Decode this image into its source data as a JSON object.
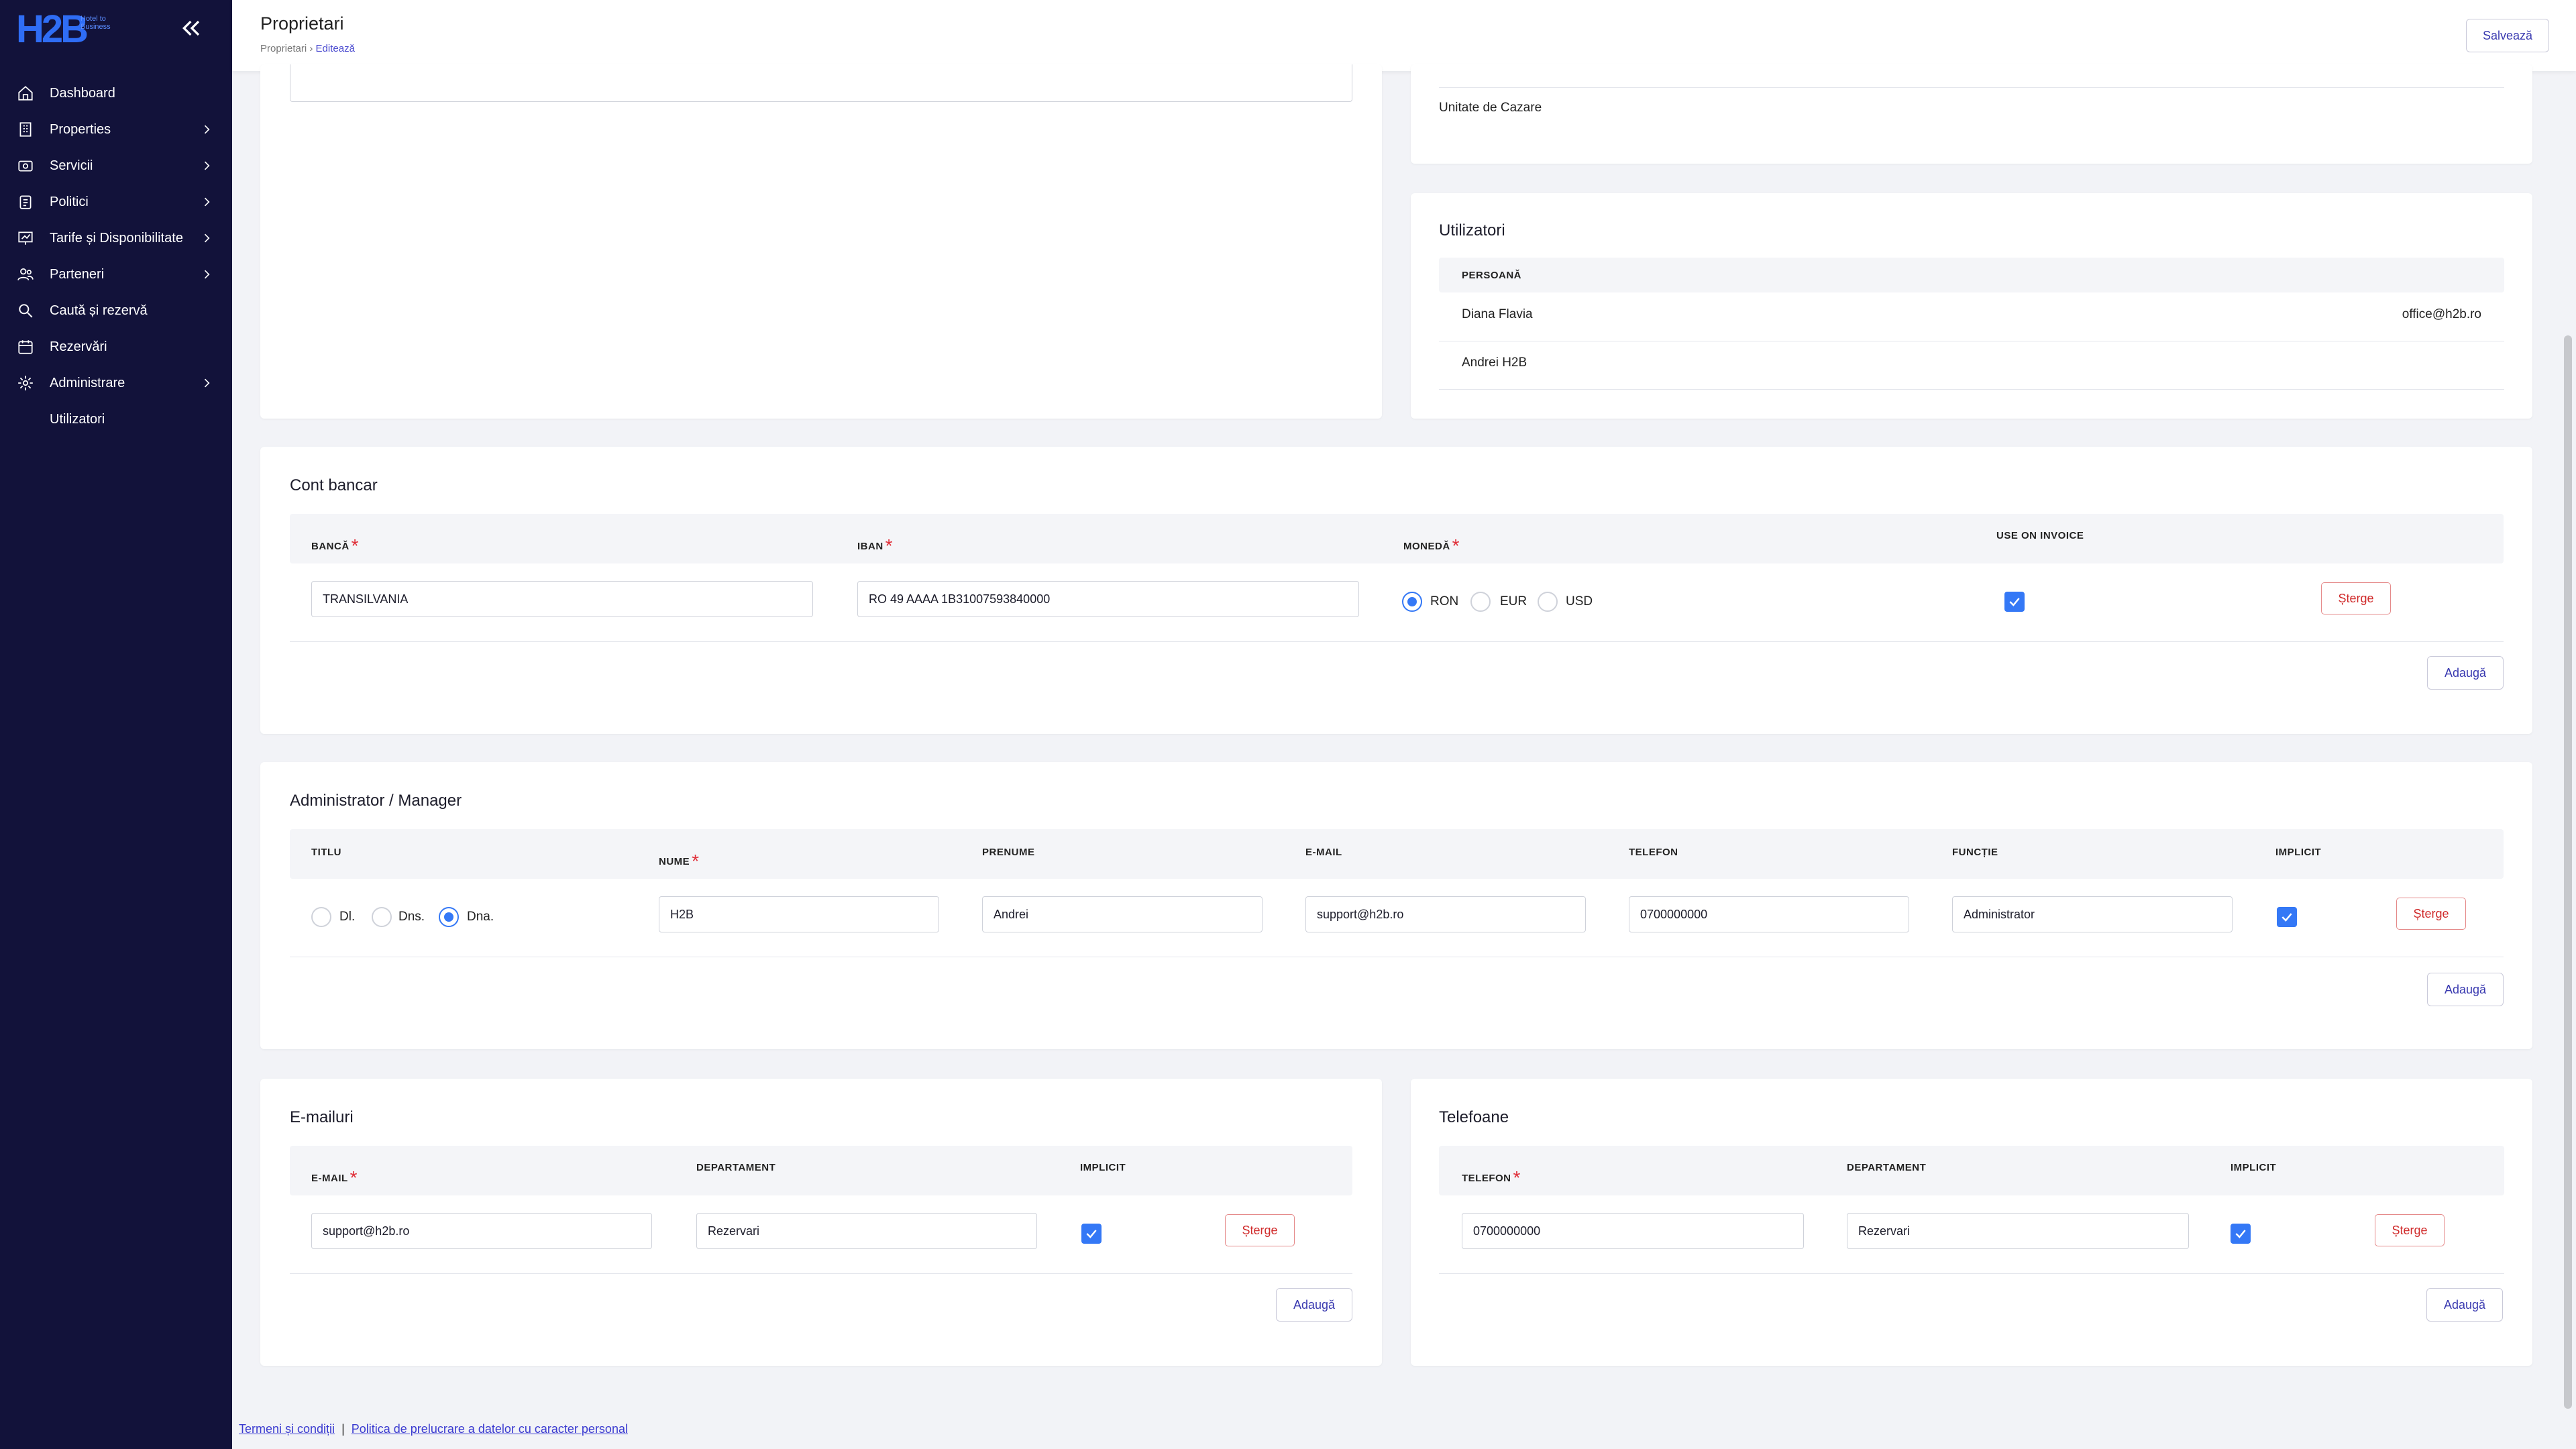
{
  "app": {
    "logo_text": "H2B",
    "logo_sub": "Hotel to Business"
  },
  "sidebar": {
    "items": [
      {
        "label": "Dashboard"
      },
      {
        "label": "Properties"
      },
      {
        "label": "Servicii"
      },
      {
        "label": "Politici"
      },
      {
        "label": "Tarife și Disponibilitate"
      },
      {
        "label": "Parteneri"
      },
      {
        "label": "Caută și rezervă"
      },
      {
        "label": "Rezervări"
      },
      {
        "label": "Administrare"
      },
      {
        "label": "Utilizatori"
      }
    ]
  },
  "header": {
    "title": "Proprietari",
    "breadcrumb_root": "Proprietari",
    "breadcrumb_sep": "›",
    "breadcrumb_current": "Editează",
    "save_label": "Salvează"
  },
  "top_right": {
    "unit_label": "Unitate de Cazare"
  },
  "users": {
    "title": "Utilizatori",
    "col_person": "PERSOANĂ",
    "rows": [
      {
        "name": "Diana Flavia",
        "email": "office@h2b.ro"
      },
      {
        "name": "Andrei H2B",
        "email": ""
      }
    ]
  },
  "bank": {
    "title": "Cont bancar",
    "col_bank": "BANCĂ",
    "col_iban": "IBAN",
    "col_currency": "MONEDĂ",
    "col_invoice": "USE ON INVOICE",
    "row": {
      "bank": "TRANSILVANIA",
      "iban": "RO 49 AAAA 1B31007593840000",
      "currency_options": [
        "RON",
        "EUR",
        "USD"
      ],
      "currency_selected": "RON",
      "use_on_invoice": true
    },
    "delete_label": "Șterge",
    "add_label": "Adaugă"
  },
  "admin": {
    "title": "Administrator / Manager",
    "col_title": "TITLU",
    "col_name": "NUME",
    "col_firstname": "PRENUME",
    "col_email": "E-MAIL",
    "col_phone": "TELEFON",
    "col_function": "FUNCȚIE",
    "col_default": "IMPLICIT",
    "row": {
      "title_options": [
        "Dl.",
        "Dns.",
        "Dna."
      ],
      "title_selected": "Dna.",
      "name": "H2B",
      "firstname": "Andrei",
      "email": "support@h2b.ro",
      "phone": "0700000000",
      "function": "Administrator",
      "default": true
    },
    "delete_label": "Șterge",
    "add_label": "Adaugă"
  },
  "emails": {
    "title": "E-mailuri",
    "col_email": "E-MAIL",
    "col_department": "DEPARTAMENT",
    "col_default": "IMPLICIT",
    "row": {
      "email": "support@h2b.ro",
      "department": "Rezervari",
      "default": true
    },
    "delete_label": "Șterge",
    "add_label": "Adaugă"
  },
  "phones": {
    "title": "Telefoane",
    "col_phone": "TELEFON",
    "col_department": "DEPARTAMENT",
    "col_default": "IMPLICIT",
    "row": {
      "phone": "0700000000",
      "department": "Rezervari",
      "default": true
    },
    "delete_label": "Șterge",
    "add_label": "Adaugă"
  },
  "footer": {
    "terms": "Termeni și condiții",
    "separator": "|",
    "privacy": "Politica de prelucrare a datelor cu caracter personal"
  },
  "colors": {
    "sidebar_bg": "#12123a",
    "accent": "#3478f6",
    "danger": "#d02b2b"
  }
}
